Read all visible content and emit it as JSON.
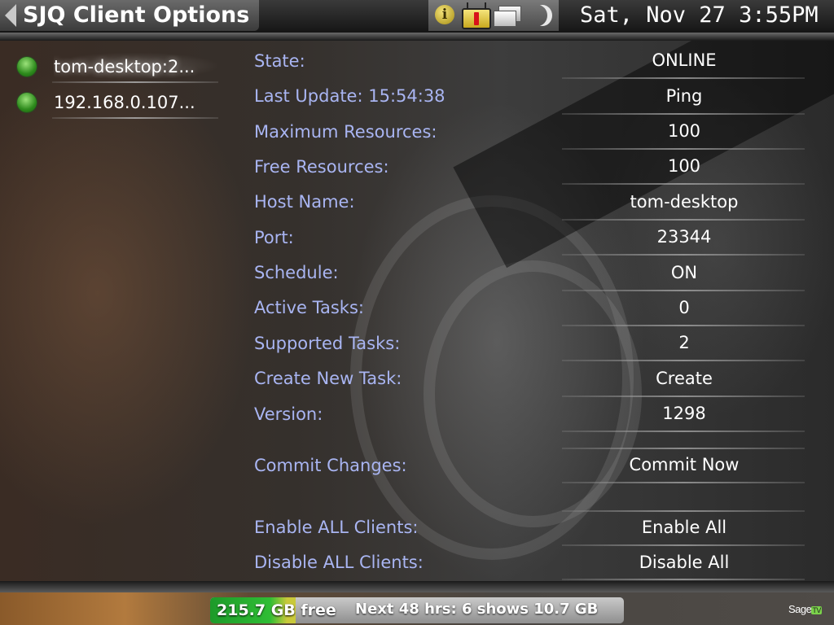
{
  "header": {
    "title": "SJQ Client Options",
    "clock": "Sat, Nov 27 3:55PM",
    "icons": [
      "info-icon",
      "tv-alert-icon",
      "windows-icon",
      "moon-icon"
    ]
  },
  "clients": [
    {
      "label": "tom-desktop:2...",
      "status_color": "#3fa72a"
    },
    {
      "label": "192.168.0.107...",
      "status_color": "#3fa72a"
    }
  ],
  "properties": [
    {
      "label": "State:",
      "value": "ONLINE"
    },
    {
      "label": "Last Update: 15:54:38",
      "value": "Ping"
    },
    {
      "label": "Maximum Resources:",
      "value": "100"
    },
    {
      "label": "Free Resources:",
      "value": "100"
    },
    {
      "label": "Host Name:",
      "value": "tom-desktop"
    },
    {
      "label": "Port:",
      "value": "23344"
    },
    {
      "label": "Schedule:",
      "value": "ON"
    },
    {
      "label": "Active Tasks:",
      "value": "0"
    },
    {
      "label": "Supported Tasks:",
      "value": "2"
    },
    {
      "label": "Create New Task:",
      "value": "Create"
    },
    {
      "label": "Version:",
      "value": "1298"
    },
    {
      "label": "Commit Changes:",
      "value": "Commit Now"
    },
    {
      "label": "Enable ALL Clients:",
      "value": "Enable All"
    },
    {
      "label": "Disable ALL Clients:",
      "value": "Disable All"
    }
  ],
  "status_bar": {
    "disk_free": "215.7 GB free",
    "disk_used_fraction": 0.2,
    "next_shows": "Next 48 hrs: 6 shows 10.7 GB",
    "brand": "Sage",
    "brand_suffix": "TV"
  },
  "colors": {
    "label": "#a9b5f2",
    "value": "#ffffff",
    "online_indicator": "#3fa72a"
  }
}
